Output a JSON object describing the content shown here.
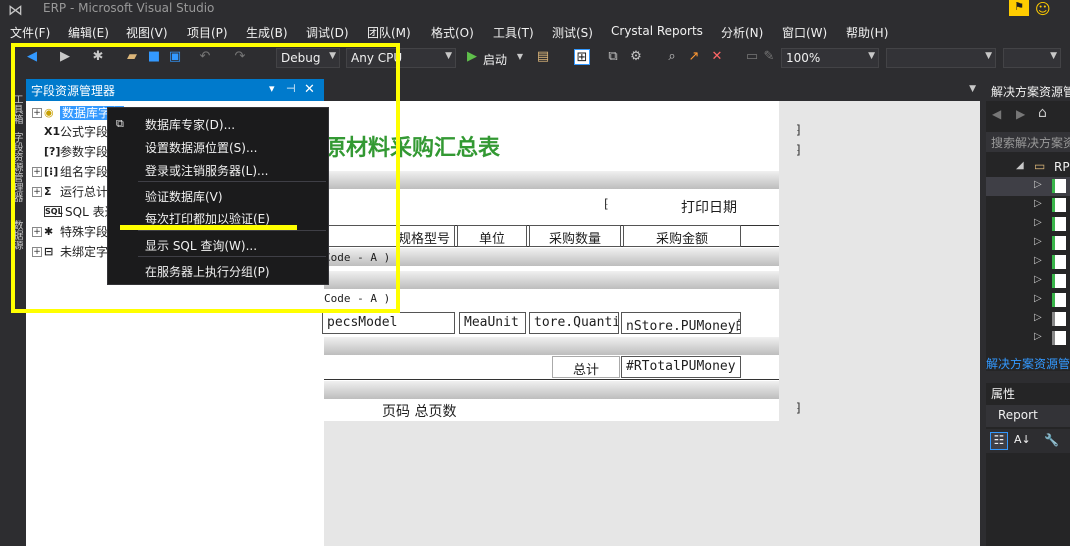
{
  "window": {
    "title": "ERP - Microsoft Visual Studio",
    "notify_icon": "flag-icon",
    "feedback_icon": "smiley-icon"
  },
  "menu": [
    "文件(F)",
    "编辑(E)",
    "视图(V)",
    "项目(P)",
    "生成(B)",
    "调试(D)",
    "团队(M)",
    "格式(O)",
    "工具(T)",
    "测试(S)",
    "Crystal Reports",
    "分析(N)",
    "窗口(W)",
    "帮助(H)"
  ],
  "toolbar": {
    "config": "Debug",
    "platform": "Any CPU",
    "start_label": "启动",
    "zoom": "100%"
  },
  "left_tabs": [
    "工具箱",
    "字段资源管理器",
    "数据源"
  ],
  "field_explorer": {
    "title": "字段资源管理器",
    "items": [
      {
        "label": "数据库字段",
        "icon": "database-icon",
        "expand": "+"
      },
      {
        "label": "公式字段",
        "icon": "formula-icon",
        "expand": ""
      },
      {
        "label": "参数字段",
        "icon": "parameter-icon",
        "expand": ""
      },
      {
        "label": "组名字段",
        "icon": "group-icon",
        "expand": "+"
      },
      {
        "label": "运行总计字段",
        "icon": "sum-icon",
        "expand": "+"
      },
      {
        "label": "SQL 表达式字段",
        "icon": "sql-icon",
        "expand": ""
      },
      {
        "label": "特殊字段",
        "icon": "special-icon",
        "expand": "+"
      },
      {
        "label": "未绑定字段",
        "icon": "unbound-icon",
        "expand": "+"
      }
    ]
  },
  "context_menu": {
    "items": [
      "数据库专家(D)...",
      "设置数据源位置(S)...",
      "登录或注销服务器(L)...",
      "验证数据库(V)",
      "每次打印都加以验证(E)",
      "显示 SQL 查询(W)...",
      "在服务器上执行分组(P)"
    ]
  },
  "report": {
    "title": "原材料采购汇总表",
    "print_date_label": "打印日期",
    "columns": [
      "规格型号",
      "单位",
      "采购数量",
      "采购金额"
    ],
    "group_header_1": "Code - A )",
    "group_header_2": "Code - A )",
    "detail_fields": [
      "pecsModel",
      "MeaUnit",
      "tore.Quanti",
      "nStore.PUMoney的"
    ],
    "total_label": "总计",
    "total_field": "#RTotalPUMoney",
    "footer_label": "页码  总页数"
  },
  "solution_explorer": {
    "title": "解决方案资源管理器",
    "search_placeholder": "搜索解决方案资源管理器",
    "root_label": "RP",
    "footer": "解决方案资源管理器"
  },
  "properties": {
    "title": "属性",
    "object": "Report"
  },
  "colors": {
    "accent": "#007acc",
    "highlight": "#ffff00",
    "report_title": "#339933"
  }
}
